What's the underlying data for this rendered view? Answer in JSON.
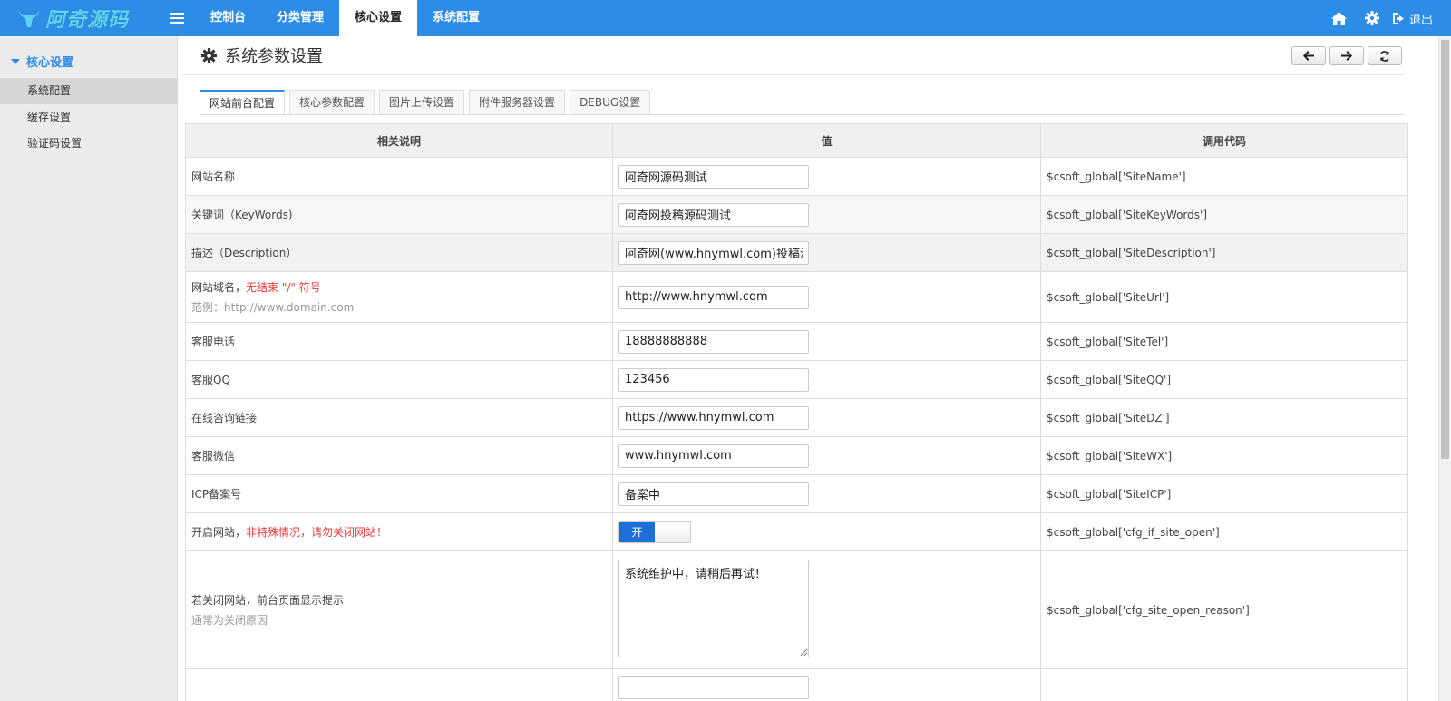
{
  "logo": {
    "text": "阿奇源码"
  },
  "nav": {
    "items": [
      {
        "label": "控制台",
        "active": false
      },
      {
        "label": "分类管理",
        "active": false
      },
      {
        "label": "核心设置",
        "active": true
      },
      {
        "label": "系统配置",
        "active": false
      }
    ],
    "logout_label": "退出"
  },
  "sidebar": {
    "section": "核心设置",
    "items": [
      {
        "label": "系统配置",
        "active": true
      },
      {
        "label": "缓存设置",
        "active": false
      },
      {
        "label": "验证码设置",
        "active": false
      }
    ]
  },
  "page": {
    "title": "系统参数设置"
  },
  "tabs": [
    {
      "label": "网站前台配置",
      "active": true
    },
    {
      "label": "核心参数配置",
      "active": false
    },
    {
      "label": "图片上传设置",
      "active": false
    },
    {
      "label": "附件服务器设置",
      "active": false
    },
    {
      "label": "DEBUG设置",
      "active": false
    }
  ],
  "table": {
    "headers": [
      "相关说明",
      "值",
      "调用代码"
    ],
    "rows": [
      {
        "desc": "网站名称",
        "value": "阿奇网源码测试",
        "code": "$csoft_global['SiteName']"
      },
      {
        "desc": "关键词（KeyWords)",
        "value": "阿奇网投稿源码测试",
        "code": "$csoft_global['SiteKeyWords']"
      },
      {
        "desc": "描述（Description）",
        "value": "阿奇网(www.hnymwl.com)投稿源码测试",
        "code": "$csoft_global['SiteDescription']"
      },
      {
        "desc": "网站域名，",
        "desc_red": "无结束 \"/\" 符号",
        "hint": "范例：http://www.domain.com",
        "value": "http://www.hnymwl.com",
        "code": "$csoft_global['SiteUrl']"
      },
      {
        "desc": "客服电话",
        "value": "18888888888",
        "code": "$csoft_global['SiteTel']"
      },
      {
        "desc": "客服QQ",
        "value": "123456",
        "code": "$csoft_global['SiteQQ']"
      },
      {
        "desc": "在线咨询链接",
        "value": "https://www.hnymwl.com",
        "code": "$csoft_global['SiteDZ']"
      },
      {
        "desc": "客服微信",
        "value": "www.hnymwl.com",
        "code": "$csoft_global['SiteWX']"
      },
      {
        "desc": "ICP备案号",
        "value": "备案中",
        "code": "$csoft_global['SiteICP']"
      },
      {
        "desc": "开启网站，",
        "desc_red": "非特殊情况，请勿关闭网站！",
        "toggle_label": "开",
        "code": "$csoft_global['cfg_if_site_open']"
      },
      {
        "desc": "若关闭网站，前台页面显示提示",
        "hint": "通常为关闭原因",
        "value": "系统维护中，请稍后再试！",
        "code": "$csoft_global['cfg_site_open_reason']"
      }
    ]
  },
  "colors": {
    "primary": "#2d8ce6",
    "toggle_on": "#1e6fd9",
    "warning": "#e4393c"
  }
}
